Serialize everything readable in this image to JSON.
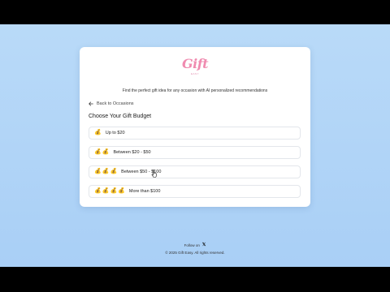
{
  "brand": {
    "logo_text": "Gift",
    "logo_sub": "EASY"
  },
  "tagline": "Find the perfect gift idea for any occasion with AI personalized recommendations",
  "back_link": "Back to Occasions",
  "heading": "Choose Your Gift Budget",
  "options": [
    {
      "label": "Up to $20",
      "bags": 1
    },
    {
      "label": "Between $20 - $50",
      "bags": 2
    },
    {
      "label": "Between $50 - $100",
      "bags": 3
    },
    {
      "label": "More than $100",
      "bags": 4
    }
  ],
  "bag_glyph": "💰",
  "footer": {
    "follow_label": "Follow on",
    "social_icon": "x-icon",
    "copyright": "© 2025 Gift Easy. All rights reserved."
  },
  "colors": {
    "background": "#b9daf8",
    "card": "#ffffff",
    "logo": "#f08bb0"
  }
}
